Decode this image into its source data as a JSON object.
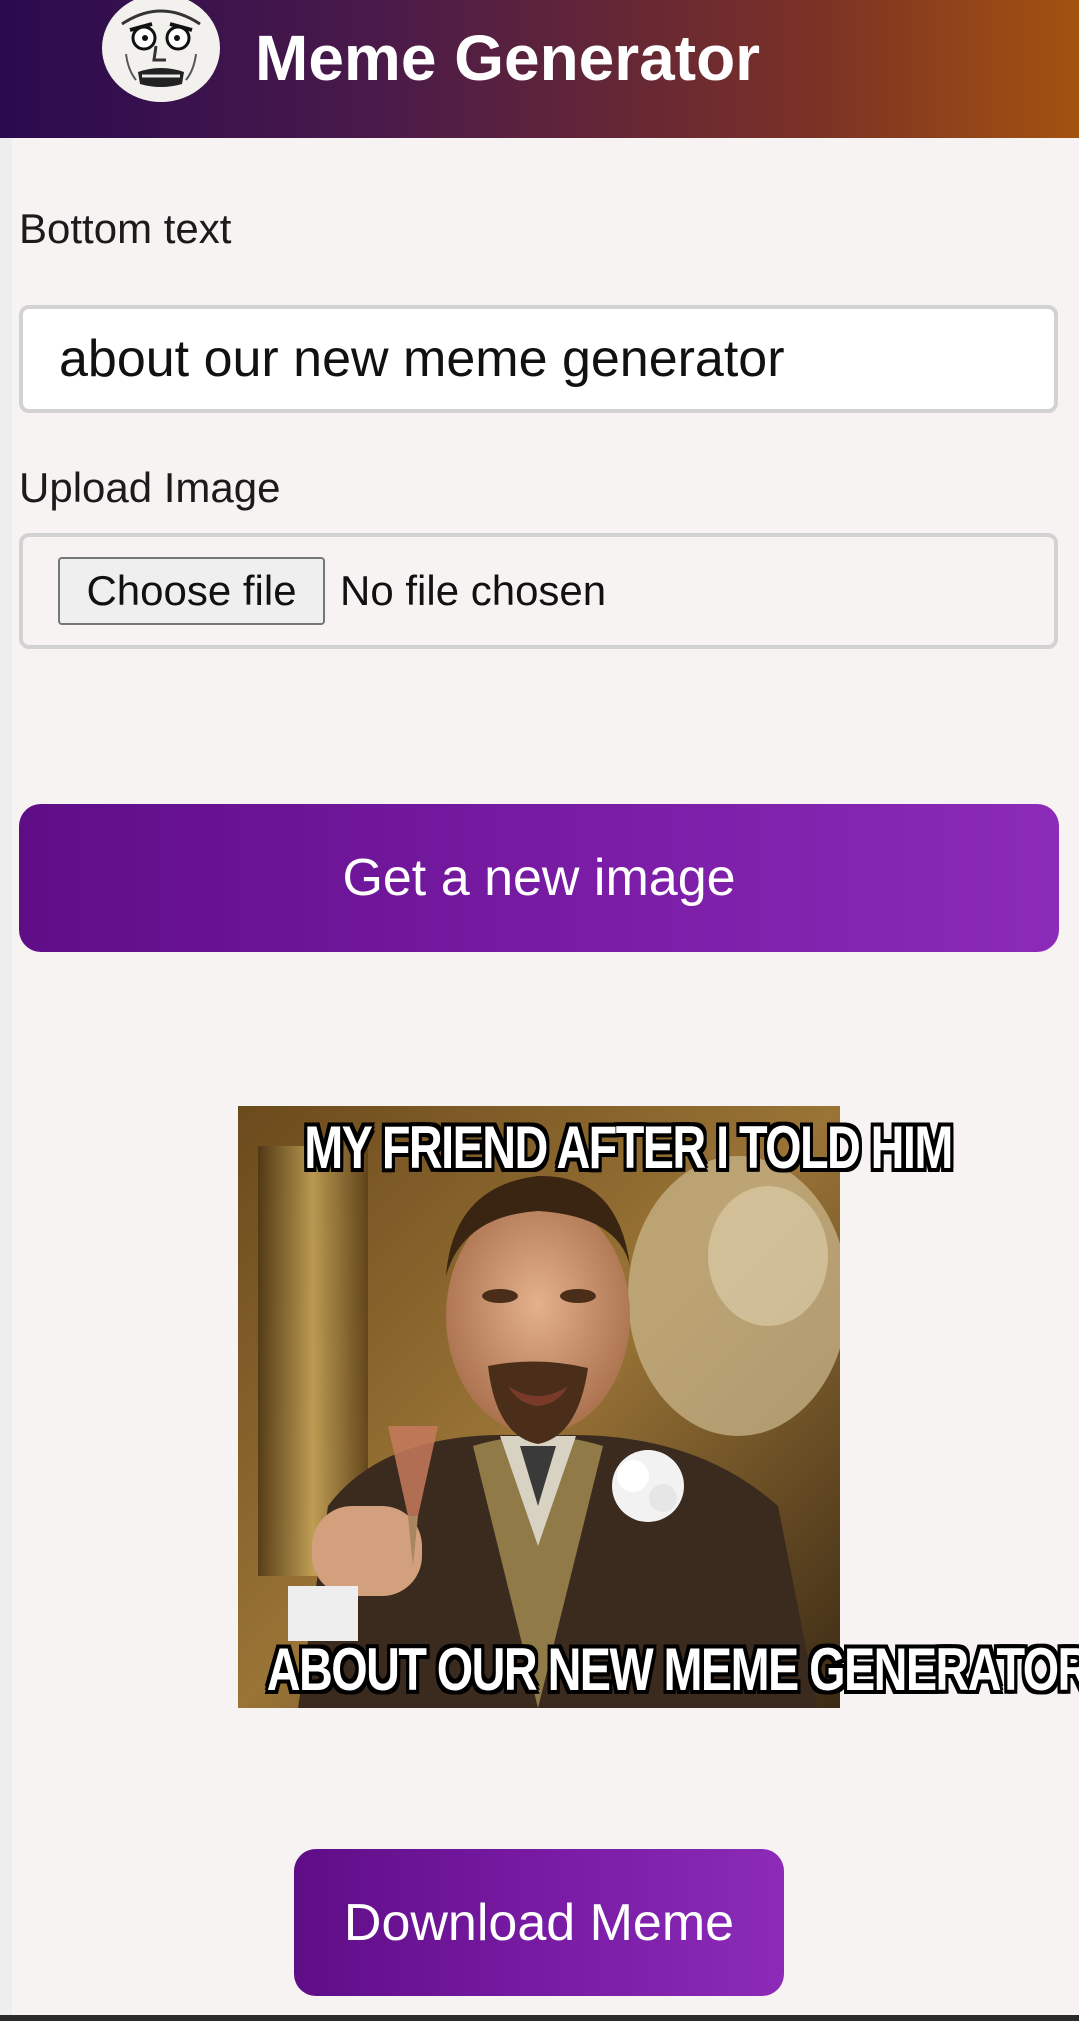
{
  "header": {
    "title": "Meme Generator",
    "logo_icon": "rage-face-logo-icon",
    "gradient_colors": [
      "#2a0a4f",
      "#a3520f"
    ]
  },
  "form": {
    "bottom_text_label": "Bottom text",
    "bottom_text_value": "about our new meme generator",
    "upload_label": "Upload Image",
    "choose_file_label": "Choose file",
    "file_status": "No file chosen",
    "new_image_button": "Get a new image"
  },
  "meme": {
    "top_caption": "MY FRIEND AFTER I TOLD HIM",
    "bottom_caption": "ABOUT OUR NEW MEME GENERATOR"
  },
  "download_button": "Download Meme",
  "colors": {
    "button_gradient_start": "#5f0d87",
    "button_gradient_end": "#8b2bb8",
    "page_background": "#f7f3f2"
  }
}
